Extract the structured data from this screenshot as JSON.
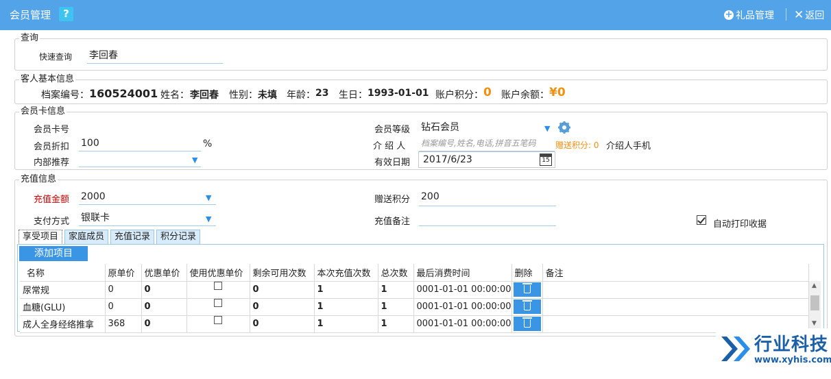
{
  "titlebar": {
    "title": "会员管理",
    "help": "?",
    "gift_label": "礼品管理",
    "back_label": "返回"
  },
  "query": {
    "legend": "查询",
    "quick_label": "快速查询",
    "quick_value": "李回春"
  },
  "guest": {
    "legend": "客人基本信息",
    "file_no_label": "档案编号：",
    "file_no": "160524001",
    "name_label": "姓名：",
    "name": "李回春",
    "gender_label": "性别：",
    "gender": "未填",
    "age_label": "年龄：",
    "age": "23",
    "birthday_label": "生日：",
    "birthday": "1993-01-01",
    "points_label": "账户积分：",
    "points": "0",
    "balance_label": "账户余额：",
    "balance": "¥0"
  },
  "card": {
    "legend": "会员卡信息",
    "card_no_label": "会员卡号",
    "discount_label": "会员折扣",
    "discount_value": "100",
    "discount_unit": "%",
    "referral_label": "内部推荐",
    "level_label": "会员等级",
    "level_value": "钻石会员",
    "introducer_label": "介 绍 人",
    "introducer_placeholder": "档案编号,姓名,电话,拼音五笔码",
    "bonus_points": "赠送积分: 0",
    "introducer_phone_label": "介绍人手机",
    "valid_date_label": "有效日期",
    "valid_date_value": "2017/6/23",
    "calendar_day": "15"
  },
  "recharge": {
    "legend": "充值信息",
    "amount_label": "充值金额",
    "amount_value": "2000",
    "pay_label": "支付方式",
    "pay_value": "银联卡",
    "gift_points_label": "赠送积分",
    "gift_points_value": "200",
    "remark_label": "充值备注",
    "auto_print_label": "自动打印收据",
    "auto_print_checked": true
  },
  "tabs": [
    "享受项目",
    "家庭成员",
    "充值记录",
    "积分记录"
  ],
  "add_button": "添加项目",
  "table": {
    "headers": [
      "名称",
      "原单价",
      "优惠单价",
      "使用优惠单价",
      "剩余可用次数",
      "本次充值次数",
      "总次数",
      "最后消费时间",
      "删除",
      "备注"
    ],
    "rows": [
      {
        "name": "尿常规",
        "price": "0",
        "discount_price": "0",
        "use_discount": false,
        "remaining": "0",
        "this_times": "1",
        "total": "1",
        "last_time": "0001-01-01 00:00:00",
        "remark": ""
      },
      {
        "name": "血糖(GLU)",
        "price": "0",
        "discount_price": "0",
        "use_discount": false,
        "remaining": "0",
        "this_times": "1",
        "total": "1",
        "last_time": "0001-01-01 00:00:00",
        "remark": ""
      },
      {
        "name": "成人全身经络推拿",
        "price": "368",
        "discount_price": "0",
        "use_discount": false,
        "remaining": "0",
        "this_times": "1",
        "total": "1",
        "last_time": "0001-01-01 00:00:00",
        "remark": ""
      }
    ]
  },
  "logo": {
    "name": "行业科技",
    "url": "www.xyhis.com"
  },
  "colors": {
    "titlebar": "#52a3e8",
    "accent_button": "#3a95e5",
    "highlight": "#f09010",
    "required_label": "#d00000"
  }
}
